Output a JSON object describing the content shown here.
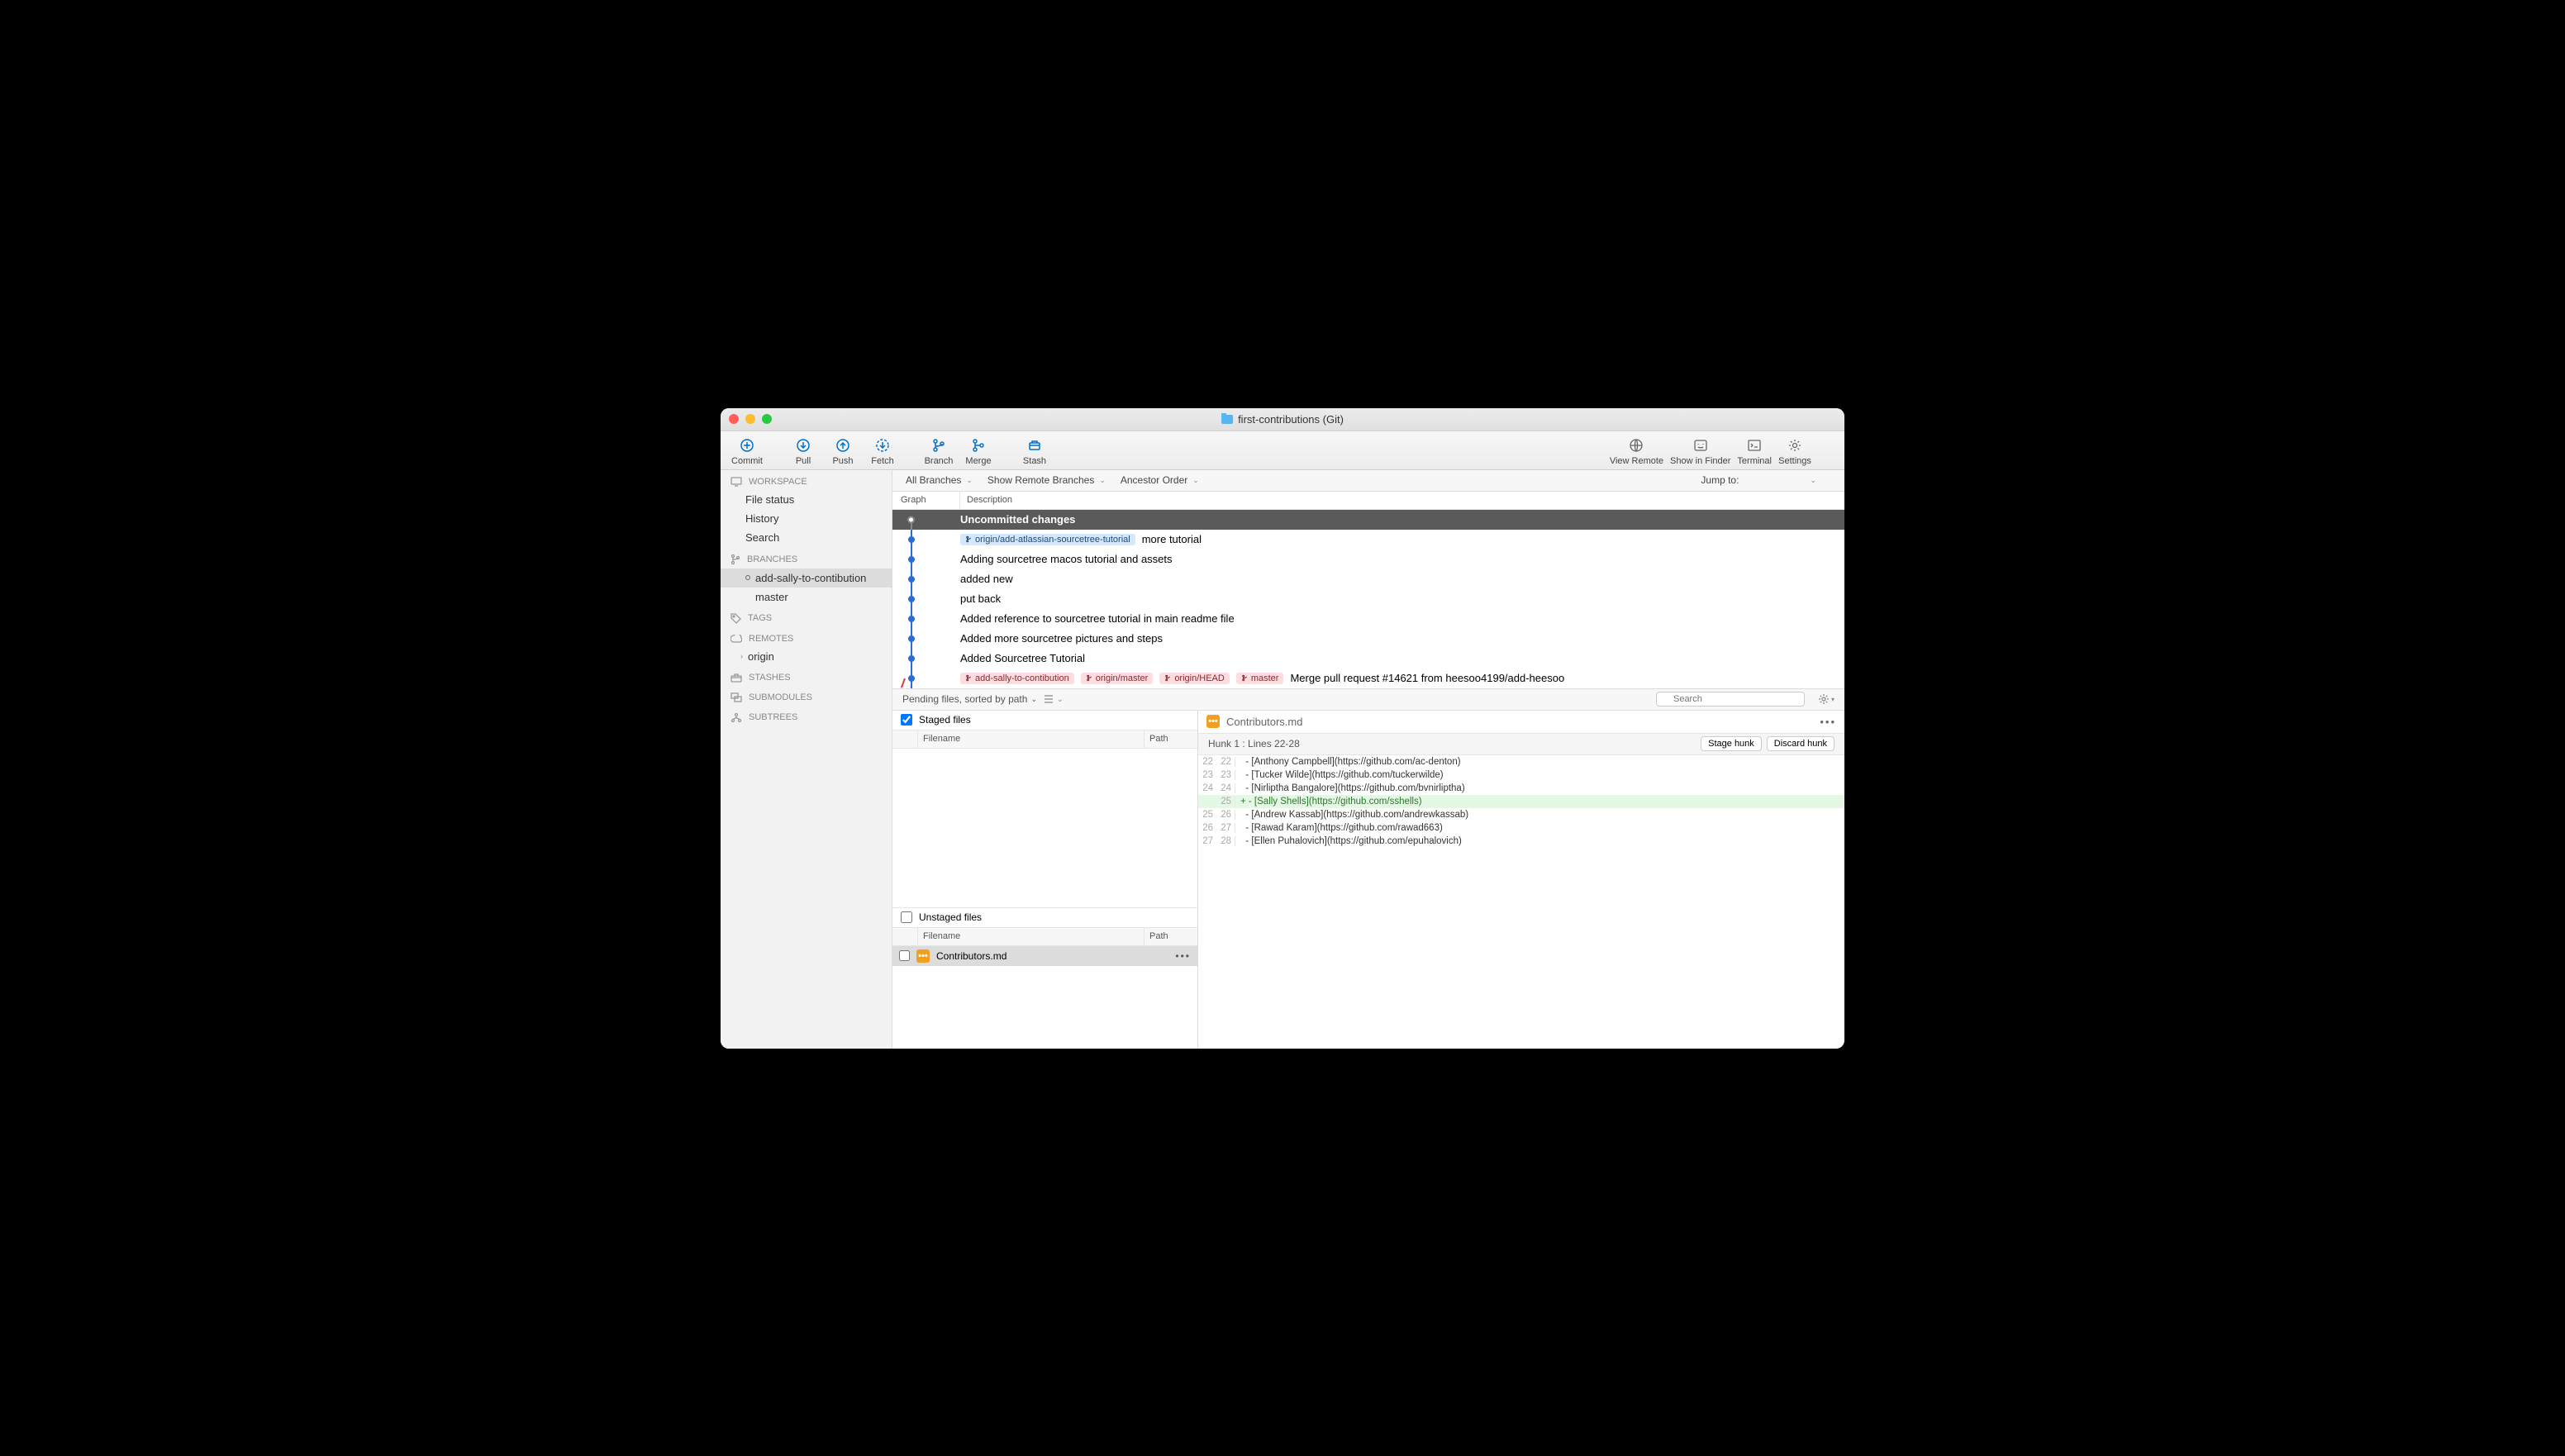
{
  "title": "first-contributions (Git)",
  "toolbar": {
    "left": [
      {
        "label": "Commit",
        "icon": "plus"
      },
      {
        "label": "Pull",
        "icon": "down"
      },
      {
        "label": "Push",
        "icon": "up"
      },
      {
        "label": "Fetch",
        "icon": "fetch"
      },
      {
        "label": "Branch",
        "icon": "branch"
      },
      {
        "label": "Merge",
        "icon": "merge"
      },
      {
        "label": "Stash",
        "icon": "stash"
      }
    ],
    "right": [
      {
        "label": "View Remote",
        "icon": "globe"
      },
      {
        "label": "Show in Finder",
        "icon": "finder"
      },
      {
        "label": "Terminal",
        "icon": "terminal"
      },
      {
        "label": "Settings",
        "icon": "gear"
      }
    ]
  },
  "sidebar": {
    "workspace": {
      "title": "WORKSPACE",
      "items": [
        "File status",
        "History",
        "Search"
      ]
    },
    "branches": {
      "title": "BRANCHES",
      "items": [
        {
          "label": "add-sally-to-contibution",
          "selected": true,
          "current": true
        },
        {
          "label": "master",
          "selected": false,
          "current": false
        }
      ]
    },
    "tags": "TAGS",
    "remotes": "REMOTES",
    "origin": "origin",
    "stashes": "STASHES",
    "submodules": "SUBMODULES",
    "subtrees": "SUBTREES"
  },
  "filter": {
    "branches": "All Branches",
    "remote": "Show Remote Branches",
    "order": "Ancestor Order",
    "jump": "Jump to:"
  },
  "history_header": {
    "graph": "Graph",
    "description": "Description"
  },
  "commits": [
    {
      "selected": true,
      "hollow": true,
      "tags": [],
      "msg": "Uncommitted changes"
    },
    {
      "tags": [
        {
          "type": "blue",
          "label": "origin/add-atlassian-sourcetree-tutorial"
        }
      ],
      "msg": "more tutorial"
    },
    {
      "tags": [],
      "msg": "Adding sourcetree macos tutorial and assets"
    },
    {
      "tags": [],
      "msg": "added new"
    },
    {
      "tags": [],
      "msg": "put back"
    },
    {
      "tags": [],
      "msg": "Added reference to sourcetree tutorial in main readme file"
    },
    {
      "tags": [],
      "msg": "Added more sourcetree pictures and steps"
    },
    {
      "tags": [],
      "msg": "Added Sourcetree Tutorial"
    },
    {
      "tags": [
        {
          "type": "pink",
          "label": "add-sally-to-contibution"
        },
        {
          "type": "pink",
          "label": "origin/master"
        },
        {
          "type": "pink",
          "label": "origin/HEAD"
        },
        {
          "type": "pink",
          "label": "master"
        }
      ],
      "msg": "Merge pull request #14621 from heesoo4199/add-heesoo"
    }
  ],
  "pending": "Pending files, sorted by path",
  "search_placeholder": "Search",
  "staged": {
    "title": "Staged files",
    "filename": "Filename",
    "path": "Path"
  },
  "unstaged": {
    "title": "Unstaged files",
    "filename": "Filename",
    "path": "Path",
    "files": [
      {
        "name": "Contributors.md"
      }
    ]
  },
  "diff": {
    "file": "Contributors.md",
    "hunk": "Hunk 1 : Lines 22-28",
    "stage": "Stage hunk",
    "discard": "Discard hunk",
    "lines": [
      {
        "o": "22",
        "n": "22",
        "t": "  - [Anthony Campbell](https://github.com/ac-denton)"
      },
      {
        "o": "23",
        "n": "23",
        "t": "  - [Tucker Wilde](https://github.com/tuckerwilde)"
      },
      {
        "o": "24",
        "n": "24",
        "t": "  - [Nirliptha Bangalore](https://github.com/bvnirliptha)"
      },
      {
        "o": "",
        "n": "25",
        "t": "+ - [Sally Shells](https://github.com/sshells)",
        "add": true
      },
      {
        "o": "25",
        "n": "26",
        "t": "  - [Andrew Kassab](https://github.com/andrewkassab)"
      },
      {
        "o": "26",
        "n": "27",
        "t": "  - [Rawad Karam](https://github.com/rawad663)"
      },
      {
        "o": "27",
        "n": "28",
        "t": "  - [Ellen Puhalovich](https://github.com/epuhalovich)"
      }
    ]
  }
}
